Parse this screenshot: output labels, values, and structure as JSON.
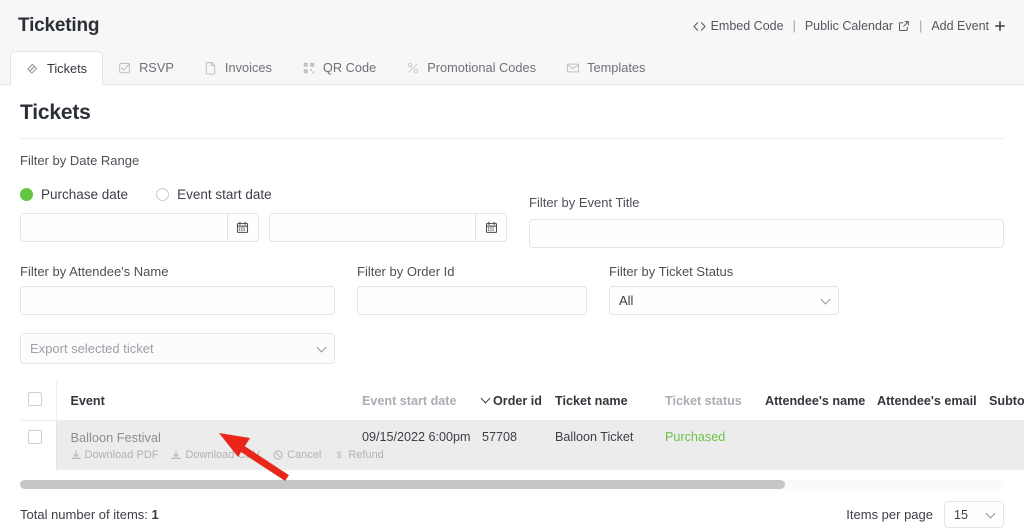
{
  "header": {
    "app_title": "Ticketing",
    "actions": [
      {
        "label": "Embed Code",
        "icon": "code-icon"
      },
      {
        "label": "Public Calendar",
        "icon": "external-link-icon"
      },
      {
        "label": "Add Event",
        "icon": "plus-icon"
      }
    ],
    "separator": "|"
  },
  "tabs": [
    {
      "label": "Tickets",
      "icon": "tickets-icon",
      "active": true
    },
    {
      "label": "RSVP",
      "icon": "check-square-icon",
      "active": false
    },
    {
      "label": "Invoices",
      "icon": "document-icon",
      "active": false
    },
    {
      "label": "QR Code",
      "icon": "qr-code-icon",
      "active": false
    },
    {
      "label": "Promotional Codes",
      "icon": "percent-icon",
      "active": false
    },
    {
      "label": "Templates",
      "icon": "envelope-icon",
      "active": false
    }
  ],
  "page": {
    "title": "Tickets"
  },
  "filters": {
    "date_range_label": "Filter by Date Range",
    "radios": [
      {
        "label": "Purchase date",
        "selected": true
      },
      {
        "label": "Event start date",
        "selected": false
      }
    ],
    "date_from": {
      "value": "",
      "placeholder": ""
    },
    "date_to": {
      "value": "",
      "placeholder": ""
    },
    "calendar_icon": "calendar-icon",
    "event_title": {
      "label": "Filter by Event Title",
      "value": "",
      "placeholder": ""
    },
    "attendee_name": {
      "label": "Filter by Attendee's Name",
      "value": "",
      "placeholder": ""
    },
    "order_id": {
      "label": "Filter by Order Id",
      "value": "",
      "placeholder": ""
    },
    "ticket_status": {
      "label": "Filter by Ticket Status",
      "value": "All",
      "options": [
        "All"
      ]
    }
  },
  "export": {
    "value": "Export selected ticket",
    "options": [
      "Export selected ticket"
    ]
  },
  "table": {
    "columns": [
      {
        "key": "check",
        "label": "",
        "muted": false
      },
      {
        "key": "event",
        "label": "Event",
        "muted": false
      },
      {
        "key": "event_start_date",
        "label": "Event start date",
        "muted": true
      },
      {
        "key": "order_id",
        "label": "Order id",
        "muted": false,
        "sorted": true
      },
      {
        "key": "ticket_name",
        "label": "Ticket name",
        "muted": false
      },
      {
        "key": "ticket_status",
        "label": "Ticket status",
        "muted": true
      },
      {
        "key": "attendee_name",
        "label": "Attendee's name",
        "muted": false
      },
      {
        "key": "attendee_email",
        "label": "Attendee's email",
        "muted": false
      },
      {
        "key": "subtotal",
        "label": "Subtotal",
        "muted": false
      }
    ],
    "rows": [
      {
        "event": "Balloon Festival",
        "actions": [
          {
            "label": "Download PDF",
            "icon": "download-icon"
          },
          {
            "label": "Download CSV",
            "icon": "download-icon"
          },
          {
            "label": "Cancel",
            "icon": "cancel-circle-icon"
          },
          {
            "label": "Refund",
            "icon": "dollar-icon"
          }
        ],
        "event_start_date": "09/15/2022 6:00pm",
        "order_id": "57708",
        "ticket_name": "Balloon Ticket",
        "ticket_status": "Purchased",
        "attendee_name": "",
        "attendee_email": "",
        "subtotal": ""
      }
    ]
  },
  "footer": {
    "total_label": "Total number of items:",
    "total_value": "1",
    "items_per_page_label": "Items per page",
    "items_per_page_value": "15",
    "items_per_page_options": [
      "15"
    ]
  },
  "colors": {
    "accent_green": "#63c541",
    "status_green": "#6cc24a",
    "annotation_red": "#e8271a"
  }
}
